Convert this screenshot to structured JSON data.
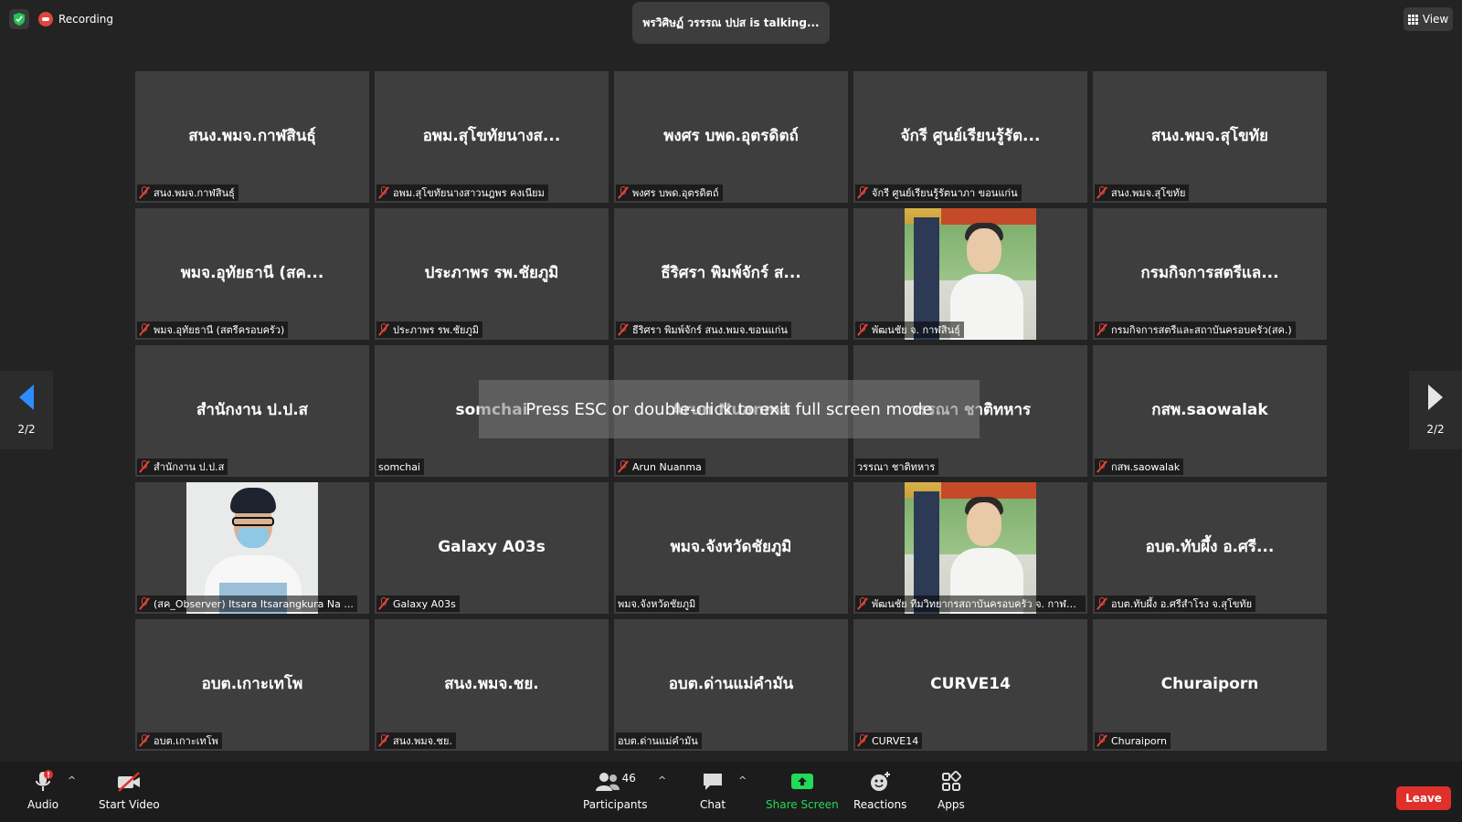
{
  "top": {
    "recording_label": "Recording",
    "talking_text": "พรวิศิษฏ์ วรรรณ ปปส is talking...",
    "view_label": "View"
  },
  "tiles": [
    {
      "name": "สนง.พมจ.กาฬสินธุ์",
      "label": "สนง.พมจ.กาฬสินธุ์",
      "muted": true
    },
    {
      "name": "อพม.สุโขทัยนางส...",
      "label": "อพม.สุโขทัยนางสาวนฎพร คงเนียม",
      "muted": true
    },
    {
      "name": "พงศร บพด.อุตรดิตถ์",
      "label": "พงศร บพด.อุตรดิตถ์",
      "muted": true
    },
    {
      "name": "จักรี ศูนย์เรียนรู้รัต...",
      "label": "จักรี ศูนย์เรียนรู้รัตนาภา ขอนแก่น",
      "muted": true
    },
    {
      "name": "สนง.พมจ.สุโขทัย",
      "label": "สนง.พมจ.สุโขทัย",
      "muted": true
    },
    {
      "name": "พมจ.อุทัยธานี (สค...",
      "label": "พมจ.อุทัยธานี (สตรีครอบครัว)",
      "muted": true
    },
    {
      "name": "ประภาพร รพ.ชัยภูมิ",
      "label": "ประภาพร รพ.ชัยภูมิ",
      "muted": true
    },
    {
      "name": "ธีริศรา พิมพ์จักร์ ส...",
      "label": "ธีริศรา พิมพ์จักร์ สนง.พมจ.ขอนแก่น",
      "muted": true
    },
    {
      "name": "",
      "label": "พัฒนชัย จ. กาฬสินธุ์",
      "muted": true,
      "photo": "sign"
    },
    {
      "name": "กรมกิจการสตรีแล...",
      "label": "กรมกิจการสตรีและสถาบันครอบครัว(สค.)",
      "muted": true
    },
    {
      "name": "สำนักงาน ป.ป.ส",
      "label": "สำนักงาน ป.ป.ส",
      "muted": true
    },
    {
      "name": "somchai",
      "label": "somchai",
      "muted": false
    },
    {
      "name": "Arun Nuanma",
      "label": "Arun Nuanma",
      "muted": true
    },
    {
      "name": "วรรณา ชาติทหาร",
      "label": "วรรณา ชาติทหาร",
      "muted": false
    },
    {
      "name": "กสพ.saowalak",
      "label": "กสพ.saowalak",
      "muted": true
    },
    {
      "name": "",
      "label": "(สค_Observer) Itsara Itsarangkura Na ...",
      "muted": true,
      "photo": "mask"
    },
    {
      "name": "Galaxy A03s",
      "label": "Galaxy A03s",
      "muted": true
    },
    {
      "name": "พมจ.จังหวัดชัยภูมิ",
      "label": "พมจ.จังหวัดชัยภูมิ",
      "muted": false
    },
    {
      "name": "",
      "label": "พัฒนชัย ทีมวิทยากรสถาบันครอบครัว จ. กาฬสินธุ์",
      "muted": true,
      "photo": "sign"
    },
    {
      "name": "อบต.ทับผึ้ง อ.ศรี...",
      "label": "อบต.ทับผึ้ง อ.ศรีสำโรง จ.สุโขทัย",
      "muted": true
    },
    {
      "name": "อบต.เกาะเทโพ",
      "label": "อบต.เกาะเทโพ",
      "muted": true
    },
    {
      "name": "สนง.พมจ.ชย.",
      "label": "สนง.พมจ.ชย.",
      "muted": true
    },
    {
      "name": "อบต.ด่านแม่คำมัน",
      "label": "อบต.ด่านแม่คำมัน",
      "muted": false
    },
    {
      "name": "CURVE14",
      "label": "CURVE14",
      "muted": true
    },
    {
      "name": "Churaiporn",
      "label": "Churaiporn",
      "muted": true
    }
  ],
  "esc_message": "Press ESC or double-click to exit full screen mode",
  "pager": {
    "left": "2/2",
    "right": "2/2"
  },
  "toolbar": {
    "audio": "Audio",
    "video": "Start Video",
    "participants": "Participants",
    "participant_count": "46",
    "chat": "Chat",
    "share": "Share Screen",
    "reactions": "Reactions",
    "apps": "Apps",
    "leave": "Leave"
  },
  "colors": {
    "accent": "#2d8cff",
    "share": "#23d959",
    "leave": "#e0302b",
    "mute": "#e0463b"
  }
}
